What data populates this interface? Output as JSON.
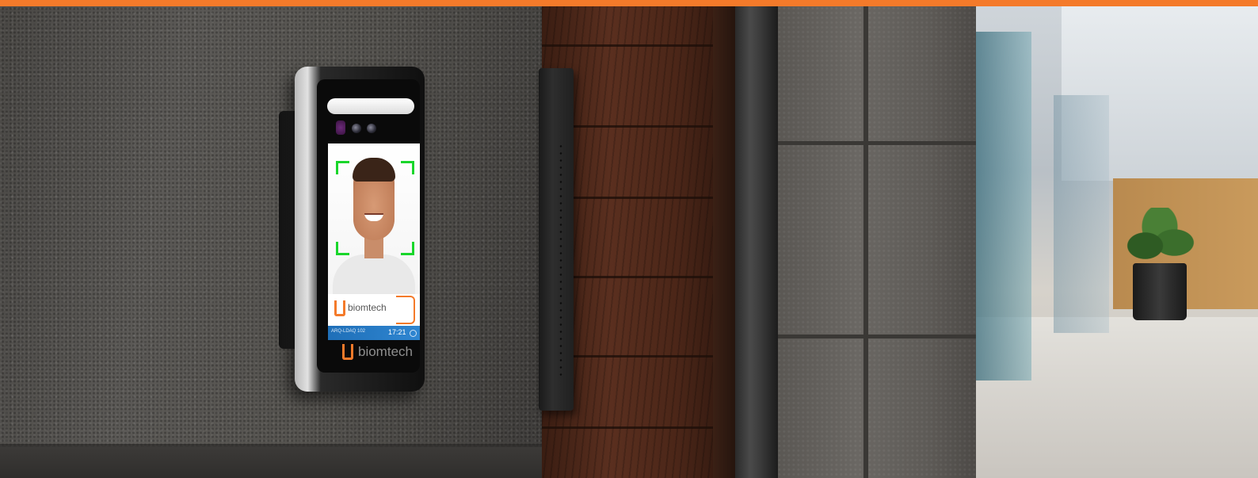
{
  "brand": {
    "accent_color": "#f47a2a",
    "screen_logo_text": "biomtech",
    "bezel_logo_text": "biomtech"
  },
  "screen": {
    "status_left_text": "ARQ-LDAQ 102",
    "time": "17:21",
    "status_icon": "clock-icon",
    "face_frame_color": "#19d62b"
  },
  "scene": {
    "plant_icon": "potted-plant-icon"
  }
}
